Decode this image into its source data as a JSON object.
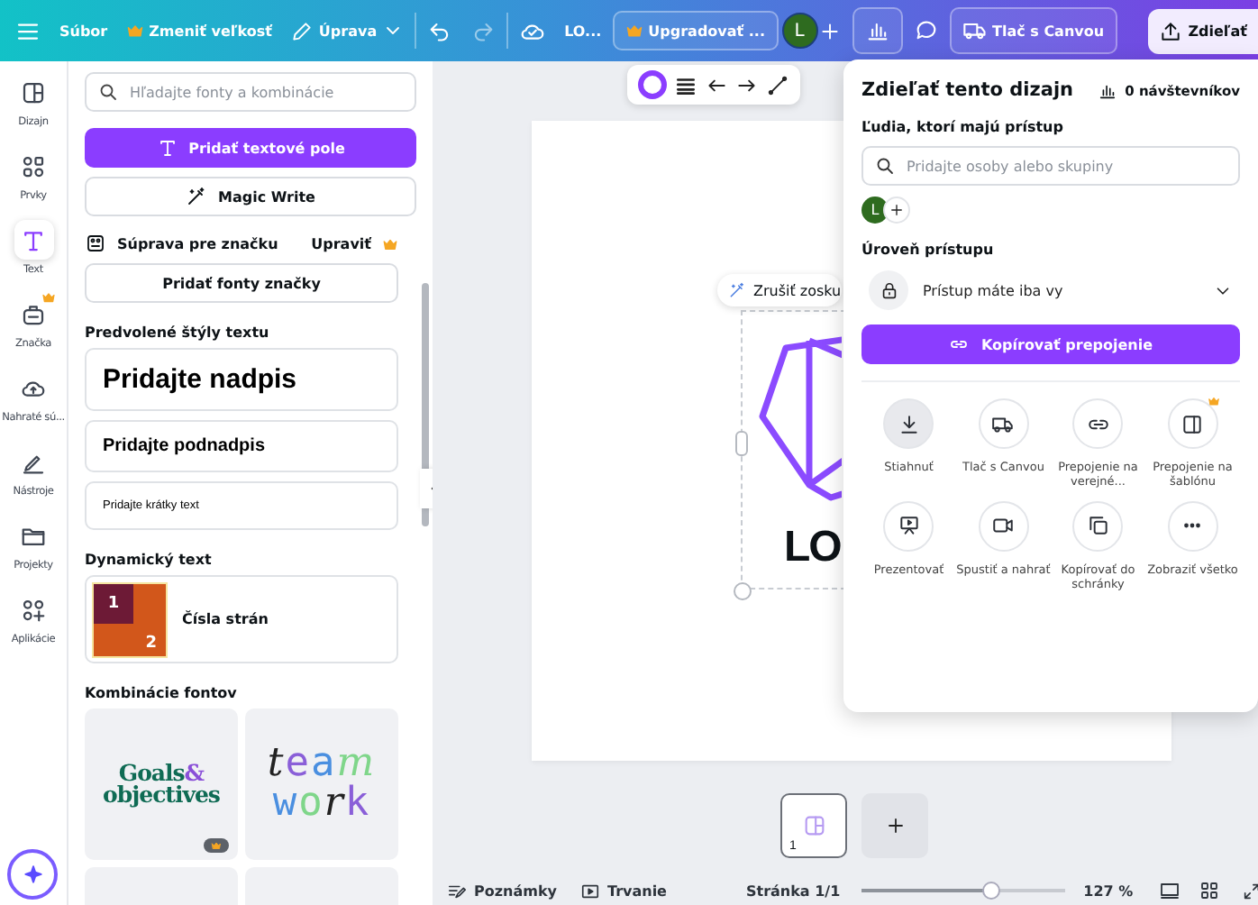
{
  "topbar": {
    "file_menu": "Súbor",
    "resize": "Zmeniť veľkosť",
    "edit": "Úprava",
    "title": "LO...",
    "upgrade": "Upgradovať ...",
    "avatar": "L",
    "print": "Tlač s Canvou",
    "share": "Zdieľať"
  },
  "rail": [
    {
      "label": "Dizajn",
      "selected": false,
      "premium": false
    },
    {
      "label": "Prvky",
      "selected": false,
      "premium": false
    },
    {
      "label": "Text",
      "selected": true,
      "premium": false
    },
    {
      "label": "Značka",
      "selected": false,
      "premium": true
    },
    {
      "label": "Nahraté sú...",
      "selected": false,
      "premium": false
    },
    {
      "label": "Nástroje",
      "selected": false,
      "premium": false
    },
    {
      "label": "Projekty",
      "selected": false,
      "premium": false
    },
    {
      "label": "Aplikácie",
      "selected": false,
      "premium": false
    }
  ],
  "panel": {
    "search": {
      "placeholder": "Hľadajte fonty a kombinácie"
    },
    "add_text_button": "Pridať textové pole",
    "magic_write_button": "Magic Write",
    "brand_kit": {
      "label": "Súprava pre značku",
      "edit": "Upraviť",
      "premium": true
    },
    "add_brand_fonts": "Pridať fonty značky",
    "default_styles_title": "Predvolené štýly textu",
    "text_styles": [
      {
        "kind": "heading",
        "text": "Pridajte nadpis"
      },
      {
        "kind": "subheading",
        "text": "Pridajte podnadpis"
      },
      {
        "kind": "body",
        "text": "Pridajte krátky text"
      }
    ],
    "dynamic_title": "Dynamický text",
    "dynamic_items": [
      {
        "label": "Čísla strán",
        "preview": [
          "1",
          "2"
        ]
      }
    ],
    "combos_title": "Kombinácie fontov",
    "font_combos": [
      {
        "kind": "serif-duo",
        "lines": [
          "Goals",
          "objectives"
        ],
        "accent": "&",
        "premium": true
      },
      {
        "kind": "mixed-letters",
        "lines": [
          "team",
          "work"
        ],
        "premium": false
      }
    ]
  },
  "canvas": {
    "ungroup": "Zrušiť zosku",
    "logo_text": "LO",
    "page_number": "1"
  },
  "bottom_bar": {
    "notes": "Poznámky",
    "duration": "Trvanie",
    "page": "Stránka 1/1",
    "zoom": {
      "level": 0.64
    },
    "zoom_reading": "127 %"
  },
  "share": {
    "title": "Zdieľať tento dizajn",
    "visitors": "0 návštevníkov",
    "people_title": "Ľudia, ktorí majú prístup",
    "people_search": {
      "placeholder": "Pridajte osoby alebo skupiny"
    },
    "avatar": "L",
    "access_title": "Úroveň prístupu",
    "access_value": "Prístup máte iba vy",
    "copy_link": "Kopírovať prepojenie",
    "actions": [
      {
        "label": "Stiahnuť",
        "highlighted": true,
        "premium": false
      },
      {
        "label": "Tlač s Canvou",
        "highlighted": false,
        "premium": false
      },
      {
        "label": "Prepojenie na verejné...",
        "highlighted": false,
        "premium": false
      },
      {
        "label": "Prepojenie na šablónu",
        "highlighted": false,
        "premium": true
      },
      {
        "label": "Prezentovať",
        "highlighted": false,
        "premium": false
      },
      {
        "label": "Spustiť a nahrať",
        "highlighted": false,
        "premium": false
      },
      {
        "label": "Kopírovať do schránky",
        "highlighted": false,
        "premium": false
      },
      {
        "label": "Zobraziť všetko",
        "highlighted": false,
        "premium": false
      }
    ]
  }
}
